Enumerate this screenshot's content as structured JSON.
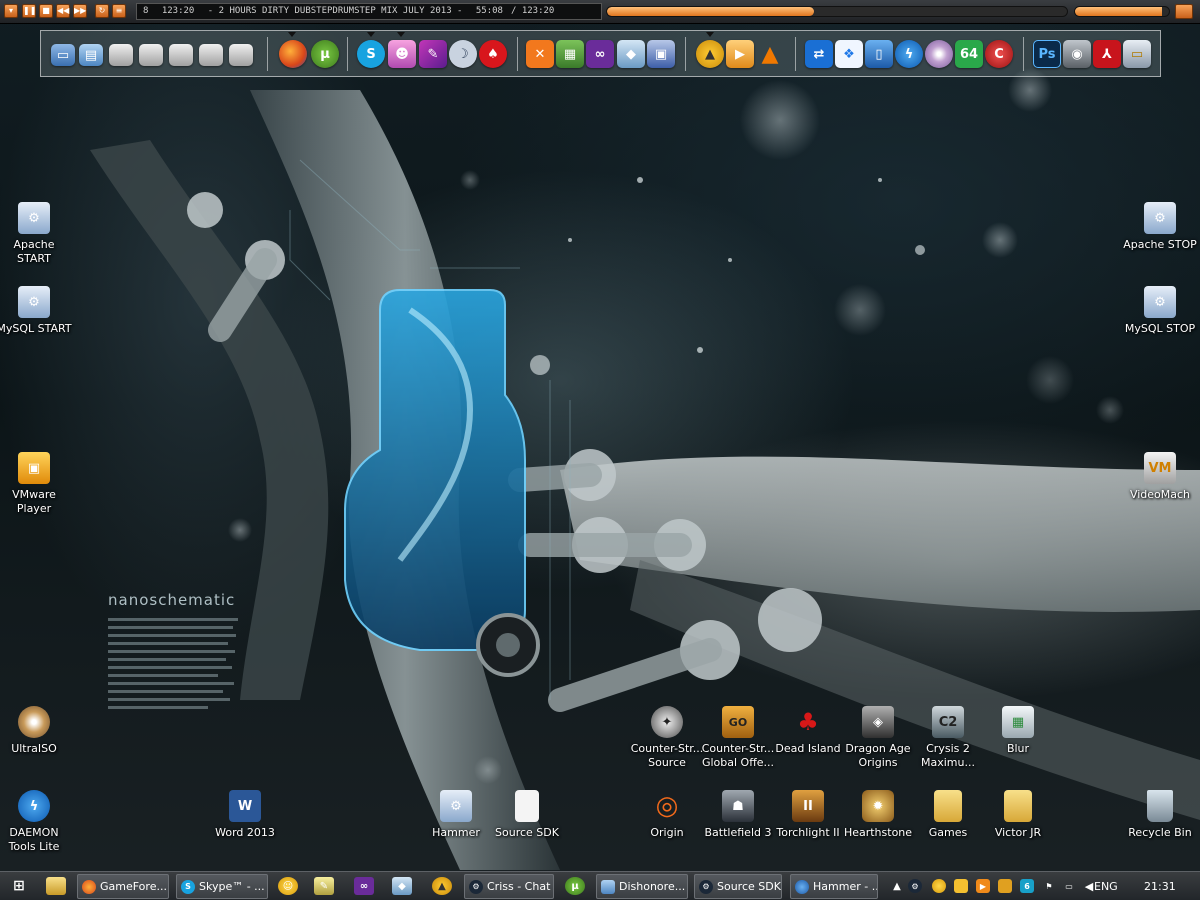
{
  "media_player": {
    "track_index": "8",
    "track_length": "123:20",
    "track_title": "- 2 HOURS DIRTY DUBSTEPDRUMSTEP MIX JULY 2013 -",
    "elapsed": "55:08",
    "total": "123:20",
    "progress": 0.45,
    "volume": 0.93,
    "accent_color": "#e0761f"
  },
  "dock": {
    "groups": [
      {
        "name": "system",
        "icons": [
          "computer-icon",
          "network-drive-icon",
          "drive-icon",
          "drive-icon",
          "drive-icon",
          "drive-icon",
          "drive-icon",
          "drive-icon"
        ]
      },
      {
        "name": "web",
        "icons": [
          "firefox-icon",
          "utorrent-icon"
        ]
      },
      {
        "name": "chat",
        "icons": [
          "skype-icon",
          "messenger-icon",
          "paint-icon",
          "moon-icon",
          "devil-icon"
        ]
      },
      {
        "name": "dev",
        "icons": [
          "xampp-icon",
          "image-editor-icon",
          "visual-studio-icon",
          "cube-icon",
          "save-icon"
        ]
      },
      {
        "name": "media",
        "icons": [
          "aimp-icon",
          "player-icon",
          "vlc-icon"
        ]
      },
      {
        "name": "utils",
        "icons": [
          "teamviewer-icon",
          "dropbox-icon",
          "phone-icon",
          "daemon-icon",
          "disc-icon",
          "aida64-icon",
          "ccleaner-icon"
        ]
      },
      {
        "name": "graphics",
        "icons": [
          "photoshop-icon",
          "camera-icon",
          "acrobat-icon",
          "screen-icon"
        ]
      }
    ]
  },
  "desktop_icons": {
    "apache_start": "Apache START",
    "mysql_start": "MySQL START",
    "vmware": "VMware Player",
    "ultraiso": "UltraISO",
    "daemon": "DAEMON Tools Lite",
    "word": "Word 2013",
    "hammer": "Hammer",
    "source_sdk": "Source SDK",
    "cs_source": "Counter-Str... Source",
    "cs_go": "Counter-Str... Global Offe...",
    "dead_island": "Dead Island",
    "dragon_age": "Dragon Age Origins",
    "crysis": "Crysis 2 Maximu...",
    "blur": "Blur",
    "origin": "Origin",
    "battlefield": "Battlefield 3",
    "torchlight": "Torchlight II",
    "hearthstone": "Hearthstone",
    "games": "Games",
    "victor": "Victor JR",
    "recycle": "Recycle Bin",
    "apache_stop": "Apache STOP",
    "mysql_stop": "MySQL STOP",
    "videomach": "VideoMach"
  },
  "wallpaper": {
    "logo_text": "nanoschematic"
  },
  "taskbar": {
    "buttons": [
      {
        "label": "GameFore...",
        "icon": "firefox-icon"
      },
      {
        "label": "Skype™ - ...",
        "icon": "skype-icon"
      },
      {
        "label": "Criss - Chat",
        "icon": "steam-icon"
      },
      {
        "label": "Dishonore...",
        "icon": "network-icon"
      },
      {
        "label": "Source SDK",
        "icon": "steam-icon"
      },
      {
        "label": "Hammer - ...",
        "icon": "globe-icon"
      }
    ],
    "language": "ENG",
    "clock": "21:31"
  }
}
